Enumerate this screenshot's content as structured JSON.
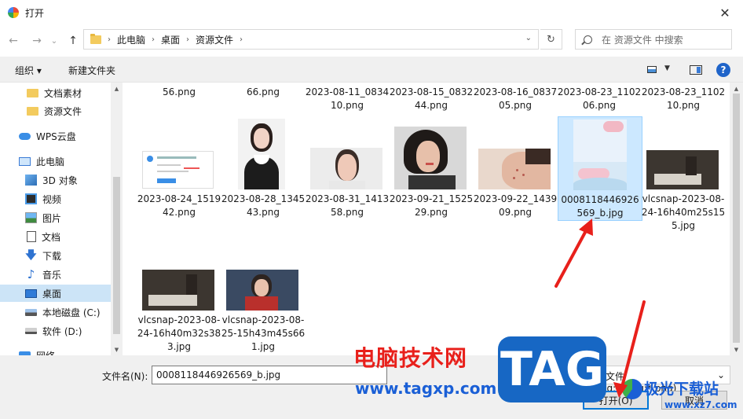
{
  "window": {
    "title": "打开",
    "close_glyph": "✕"
  },
  "nav": {
    "back_glyph": "←",
    "forward_glyph": "→",
    "dropdown_glyph": "⌄",
    "up_glyph": "↑",
    "breadcrumbs": [
      "此电脑",
      "桌面",
      "资源文件"
    ],
    "breadcrumb_sep": "›",
    "refresh_glyph": "↻",
    "search_placeholder": "在 资源文件 中搜索"
  },
  "toolbar": {
    "organize": "组织 ▾",
    "new_folder": "新建文件夹",
    "help": "?"
  },
  "sidebar": {
    "items": [
      {
        "label": "文档素材",
        "icon": "folder-icon"
      },
      {
        "label": "资源文件",
        "icon": "folder-icon"
      },
      {
        "label": "WPS云盘",
        "icon": "cloud-icon"
      },
      {
        "label": "此电脑",
        "icon": "pc-icon"
      },
      {
        "label": "3D 对象",
        "icon": "cube-icon"
      },
      {
        "label": "视频",
        "icon": "video-icon"
      },
      {
        "label": "图片",
        "icon": "picture-icon"
      },
      {
        "label": "文档",
        "icon": "document-icon"
      },
      {
        "label": "下载",
        "icon": "download-icon"
      },
      {
        "label": "音乐",
        "icon": "music-icon"
      },
      {
        "label": "桌面",
        "icon": "desktop-icon"
      },
      {
        "label": "本地磁盘 (C:)",
        "icon": "drive-icon"
      },
      {
        "label": "软件 (D:)",
        "icon": "drive-icon"
      },
      {
        "label": "网络",
        "icon": "network-icon"
      }
    ],
    "download_glyph": "🡇",
    "music_glyph": "♪",
    "scroll_up": "▲",
    "scroll_down": "▼"
  },
  "files": [
    {
      "name": "56.png"
    },
    {
      "name": "66.png"
    },
    {
      "name": "2023-08-11_083410.png"
    },
    {
      "name": "2023-08-15_083244.png"
    },
    {
      "name": "2023-08-16_083705.png"
    },
    {
      "name": "2023-08-23_110206.png"
    },
    {
      "name": "2023-08-23_110210.png"
    },
    {
      "name": "2023-08-24_151942.png"
    },
    {
      "name": "2023-08-28_134543.png"
    },
    {
      "name": "2023-08-31_141358.png"
    },
    {
      "name": "2023-09-21_152529.png"
    },
    {
      "name": "2023-09-22_143909.png"
    },
    {
      "name": "0008118446926569_b.jpg",
      "selected": true
    },
    {
      "name": "vlcsnap-2023-08-24-16h40m25s155.jpg"
    },
    {
      "name": "vlcsnap-2023-08-24-16h40m32s383.jpg"
    },
    {
      "name": "vlcsnap-2023-08-25-15h43m45s661.jpg"
    }
  ],
  "bottom": {
    "filename_label": "文件名(N):",
    "filename_value": "0008118446926569_b.jpg",
    "filter_value": "图片文件 (*.jpg;*.jpeg;*.png)",
    "filter_dropdown": "⌄",
    "open_button": "打开(O)",
    "cancel_button": "取消"
  },
  "watermark": {
    "site_name": "电脑技术网",
    "site_url": "www.tagxp.com",
    "logo_text": "TAG",
    "brand_right": "极光下载站",
    "brand_right_url": "www.xz7.com"
  },
  "colors": {
    "selection": "#cce8ff",
    "accent": "#0078d7",
    "annotation_arrow": "#e8201b"
  }
}
